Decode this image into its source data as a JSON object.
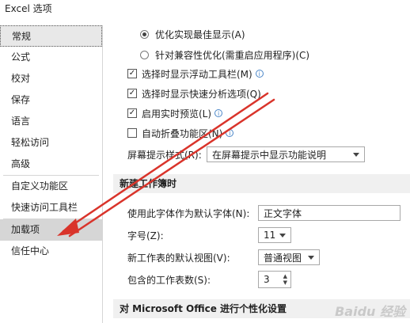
{
  "window": {
    "title": "Excel 选项"
  },
  "sidebar": {
    "items": [
      {
        "label": "常规"
      },
      {
        "label": "公式"
      },
      {
        "label": "校对"
      },
      {
        "label": "保存"
      },
      {
        "label": "语言"
      },
      {
        "label": "轻松访问"
      },
      {
        "label": "高级"
      },
      {
        "label": "自定义功能区"
      },
      {
        "label": "快速访问工具栏"
      },
      {
        "label": "加载项"
      },
      {
        "label": "信任中心"
      }
    ]
  },
  "ui_options": {
    "radio_optimize_display": "优化实现最佳显示(A)",
    "radio_compat": "针对兼容性优化(需重启应用程序)(C)",
    "chk_mini_toolbar": "选择时显示浮动工具栏(M)",
    "chk_quick_analysis": "选择时显示快速分析选项(Q)",
    "chk_live_preview": "启用实时预览(L)",
    "chk_collapse_ribbon": "自动折叠功能区(N)",
    "screentip_label": "屏幕提示样式(R):",
    "screentip_value": "在屏幕提示中显示功能说明"
  },
  "new_workbook": {
    "header": "新建工作簿时",
    "font_label": "使用此字体作为默认字体(N):",
    "font_value": "正文字体",
    "size_label": "字号(Z):",
    "size_value": "11",
    "view_label": "新工作表的默认视图(V):",
    "view_value": "普通视图",
    "sheets_label": "包含的工作表数(S):",
    "sheets_value": "3"
  },
  "personalize": {
    "header": "对 Microsoft Office 进行个性化设置"
  },
  "watermark": "Baidu 经验",
  "colors": {
    "annotation_arrow": "#d9342b"
  }
}
